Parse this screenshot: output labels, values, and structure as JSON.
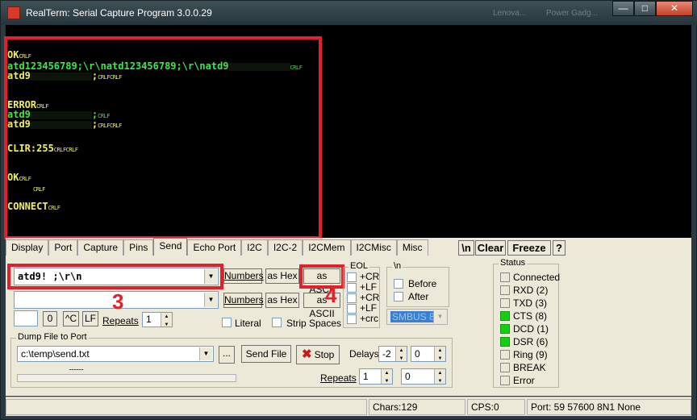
{
  "window": {
    "title": "RealTerm: Serial Capture Program 3.0.0.29",
    "blurred_title_1": "Lenova...",
    "blurred_title_2": "Power Gadg..."
  },
  "terminal": {
    "lines": [
      {
        "text": "OK",
        "color": "y",
        "crlf": "CRLF"
      },
      {
        "text": "atd123456789;\\r\\natd123456789;\\r\\natd9",
        "color": "g",
        "crlf": "CRLF"
      },
      {
        "text": "atd9",
        "color": "y",
        "after": ";",
        "crlf": "CRLFCRLF"
      },
      {
        "text": "ERROR",
        "color": "y",
        "crlf": "CRLF"
      },
      {
        "text": "atd9",
        "color": "g",
        "after": ";",
        "crlf": "CRLF"
      },
      {
        "text": "atd9",
        "color": "y",
        "after": ";",
        "crlf": "CRLFCRLF"
      },
      {
        "text": "CLIR:255",
        "color": "y",
        "crlf": "CRLFCRLF"
      },
      {
        "text": "OK",
        "color": "y",
        "crlf": "CRLF"
      },
      {
        "text": "",
        "color": "y",
        "crlf": "CRLF"
      },
      {
        "text": "CONNECT",
        "color": "y",
        "crlf": "CRLF"
      }
    ]
  },
  "tabs": [
    "Display",
    "Port",
    "Capture",
    "Pins",
    "Send",
    "Echo Port",
    "I2C",
    "I2C-2",
    "I2CMem",
    "I2CMisc",
    "Misc"
  ],
  "topbuttons": {
    "newline": "\\n",
    "clear": "Clear",
    "freeze": "Freeze",
    "help": "?"
  },
  "send": {
    "input1": "atd9!            ;\\r\\n",
    "input2": "",
    "numbers": "Numbers",
    "as_hex": "as Hex",
    "as_ascii": "as ASCII",
    "small_input": "",
    "zero": "0",
    "ctrl_c": "^C",
    "lf": "LF",
    "repeats_label": "Repeats",
    "repeats_value": "1",
    "literal": "Literal",
    "strip_spaces": "Strip Spaces"
  },
  "eol": {
    "label": "EOL",
    "items": [
      "+CR",
      "+LF",
      "+CR",
      "+LF",
      "+crc"
    ]
  },
  "newline_group": {
    "label": "\\n",
    "before": "Before",
    "after": "After",
    "smbus": "SMBUS 8"
  },
  "dump": {
    "label": "Dump File to Port",
    "file": "c:\\temp\\send.txt",
    "browse": "...",
    "send_file": "Send File",
    "stop": "Stop",
    "delays_label": "Delays",
    "delay1": "-2",
    "delay2": "0",
    "repeats_label": "Repeats",
    "repeat1": "1",
    "repeat2": "0",
    "dots": "............"
  },
  "status": {
    "label": "Status",
    "items": [
      {
        "name": "Connected",
        "on": false
      },
      {
        "name": "RXD (2)",
        "on": false
      },
      {
        "name": "TXD (3)",
        "on": false
      },
      {
        "name": "CTS (8)",
        "on": true
      },
      {
        "name": "DCD (1)",
        "on": true
      },
      {
        "name": "DSR (6)",
        "on": true
      },
      {
        "name": "Ring (9)",
        "on": false
      },
      {
        "name": "BREAK",
        "on": false
      },
      {
        "name": "Error",
        "on": false
      }
    ]
  },
  "statusbar": {
    "chars": "Chars:129",
    "cps": "CPS:0",
    "port": "Port: 59  57600 8N1 None"
  },
  "annotations": {
    "three": "3",
    "four": "4"
  },
  "colors": {
    "highlight": "#e0202a",
    "terminal_yellow": "#f0f05a",
    "terminal_green": "#3ce84a",
    "led_on": "#10d010"
  }
}
